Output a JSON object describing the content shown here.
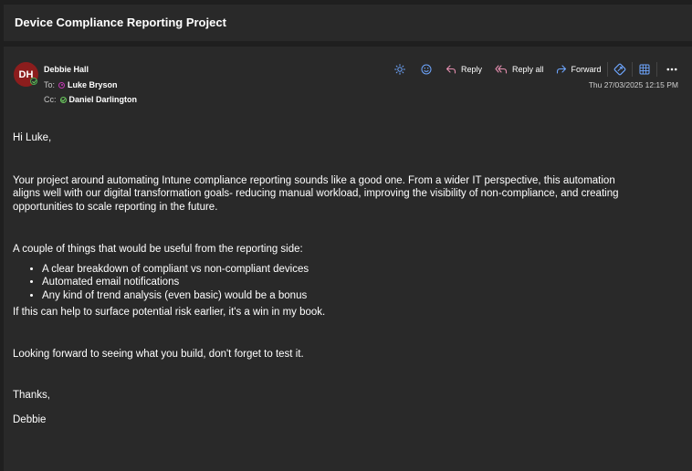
{
  "email": {
    "subject": "Device Compliance Reporting Project",
    "sender": {
      "initials": "DH",
      "name": "Debbie Hall",
      "avatar_color": "#8c1d1d"
    },
    "to": {
      "label": "To:",
      "name": "Luke Bryson",
      "presence_color": "#c239b3"
    },
    "cc": {
      "label": "Cc:",
      "name": "Daniel Darlington",
      "presence_color": "#6ccb5f"
    },
    "timestamp": "Thu 27/03/2025 12:15 PM",
    "toolbar": {
      "brightness_icon": "sun-icon",
      "emoji_icon": "smiley-icon",
      "reply": "Reply",
      "reply_all": "Reply all",
      "forward": "Forward",
      "teams_icon": "share-to-teams-icon",
      "apps_icon": "grid-icon",
      "more_icon": "more-icon"
    },
    "body": {
      "greeting": "Hi Luke,",
      "paragraph1": "Your project around automating Intune compliance reporting sounds like a good one. From a wider IT perspective, this automation aligns well with our digital transformation goals- reducing manual workload, improving the visibility of non-compliance, and creating opportunities to scale reporting in the future.",
      "paragraph2": "A couple of things that would be useful from the reporting side:",
      "bullets": [
        "A clear breakdown of compliant vs non-compliant devices",
        "Automated email notifications",
        "Any kind of trend analysis (even basic) would be a bonus"
      ],
      "paragraph3": "If this can help to surface potential risk earlier, it's a win in my book.",
      "paragraph4": "Looking forward to seeing what you build, don't forget to test it.",
      "signoff": "Thanks,",
      "signature": "Debbie"
    },
    "colors": {
      "background": "#1f1f1f",
      "panel": "#292929",
      "accent": "#6ea6ff",
      "reply_icon": "#e58fb0"
    }
  }
}
